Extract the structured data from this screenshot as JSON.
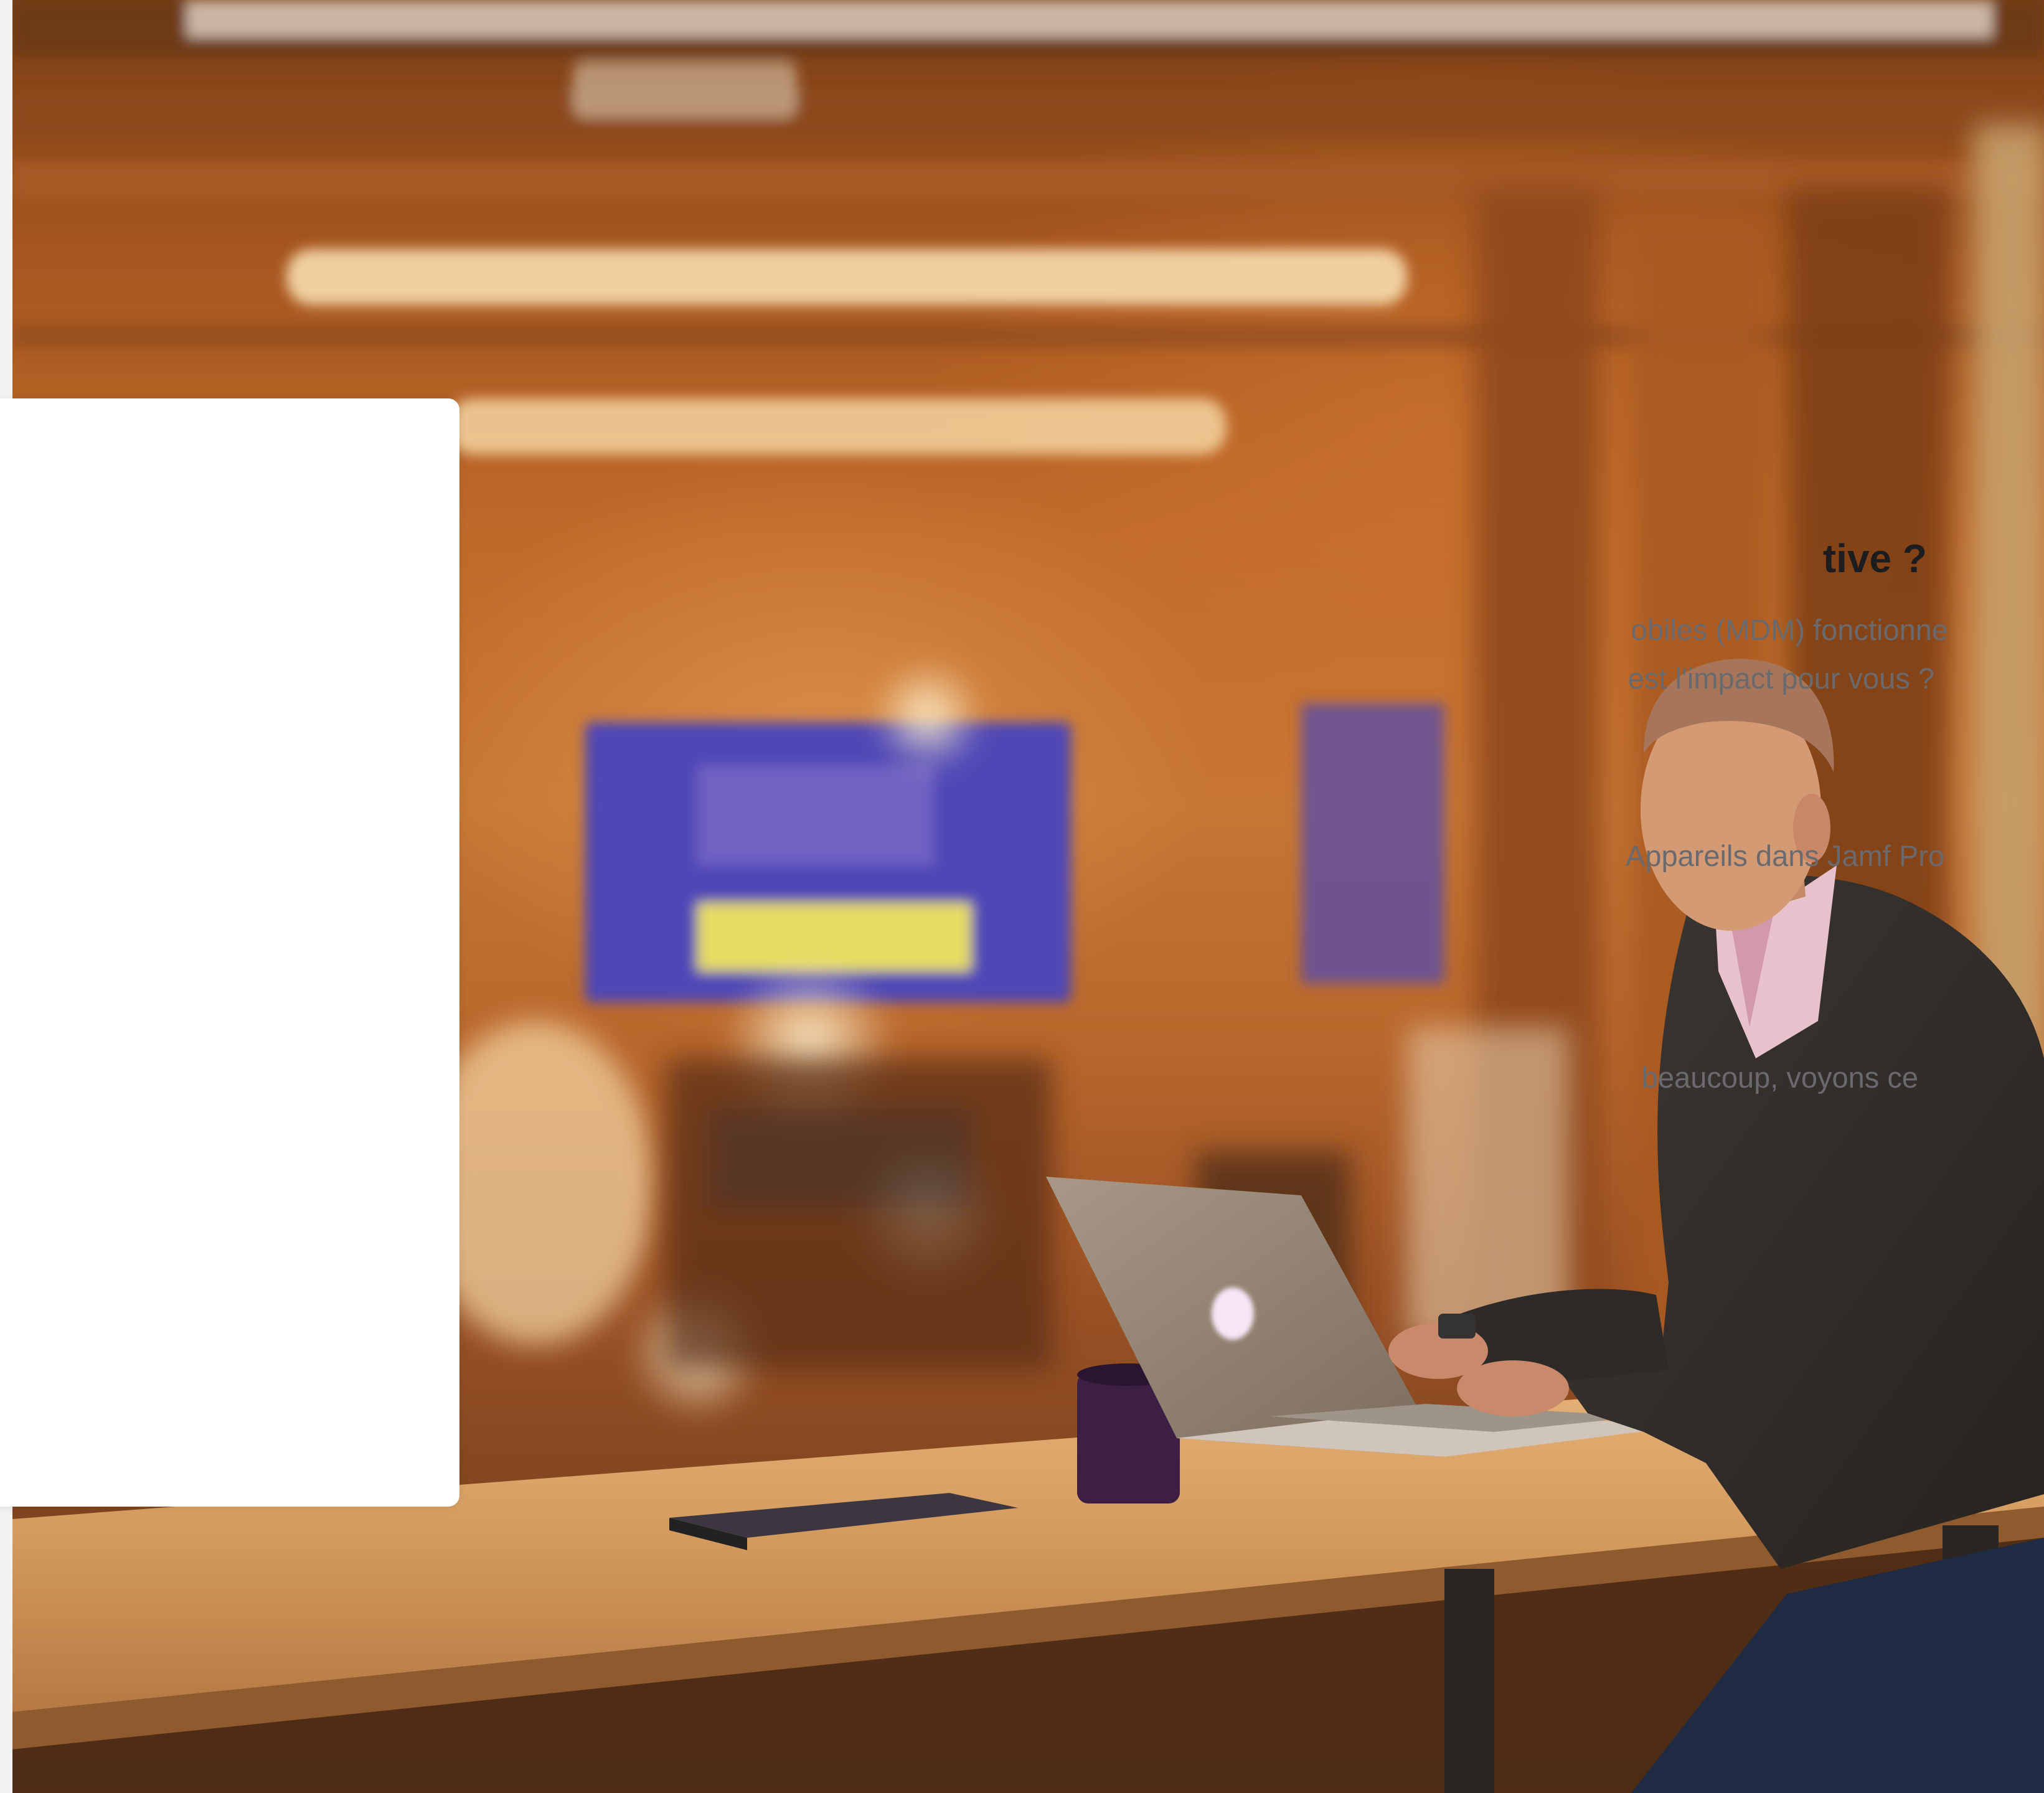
{
  "card": {
    "heading": "tive ?",
    "paragraph_1_line_1": "obiles (MDM) fonctionne",
    "paragraph_1_line_2": "est l'impact pour vous ?",
    "paragraph_2": "Appareils dans Jamf Pro",
    "paragraph_3": "beaucoup, voyons ce"
  },
  "hero_image": {
    "subject": "man-working-on-laptop-icon"
  },
  "colors": {
    "card_background": "#ffffff",
    "heading": "#1d1d1f",
    "body_text": "#6a6a6e",
    "wood_warm": "#c06a2a",
    "wood_dark": "#7a3f16"
  }
}
